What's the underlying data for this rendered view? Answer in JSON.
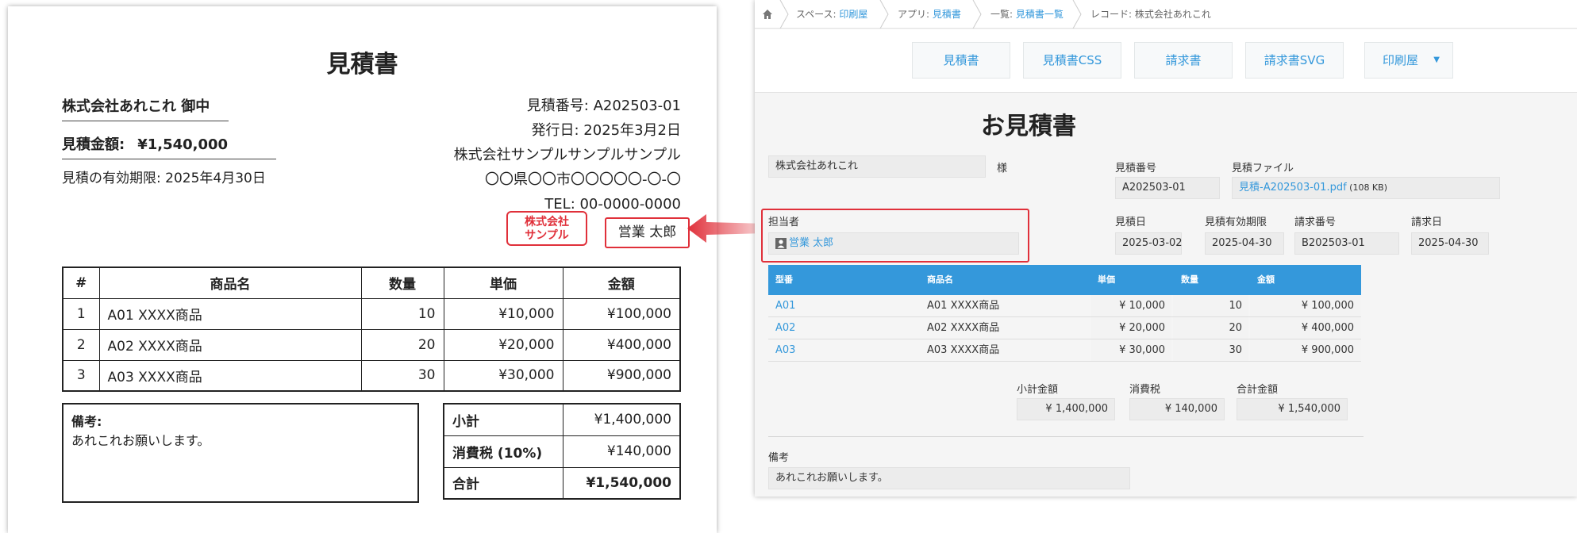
{
  "document": {
    "title": "見積書",
    "customer": "株式会社あれこれ 御中",
    "amount_label": "見積金額:",
    "amount_value": "¥1,540,000",
    "validity": "見積の有効期限: 2025年4月30日",
    "quote_number": "見積番号: A202503-01",
    "issue_date": "発行日: 2025年3月2日",
    "company": "株式会社サンプルサンプルサンプル",
    "address": "〇〇県〇〇市〇〇〇〇〇-〇-〇",
    "tel": "TEL: 00-0000-0000",
    "stamp_line1": "株式会社",
    "stamp_line2": "サンプル",
    "representative": "営業 太郎",
    "table_headers": [
      "#",
      "商品名",
      "数量",
      "単価",
      "金額"
    ],
    "items": [
      {
        "no": "1",
        "name": "A01 XXXX商品",
        "qty": "10",
        "price": "¥10,000",
        "amount": "¥100,000"
      },
      {
        "no": "2",
        "name": "A02 XXXX商品",
        "qty": "20",
        "price": "¥20,000",
        "amount": "¥400,000"
      },
      {
        "no": "3",
        "name": "A03 XXXX商品",
        "qty": "30",
        "price": "¥30,000",
        "amount": "¥900,000"
      }
    ],
    "notes_label": "備考:",
    "notes_text": "あれこれお願いします。",
    "subtotal_label": "小計",
    "subtotal": "¥1,400,000",
    "tax_label": "消費税 (10%)",
    "tax": "¥140,000",
    "total_label": "合計",
    "total": "¥1,540,000"
  },
  "app": {
    "breadcrumb": {
      "space_prefix": "スペース: ",
      "space": "印刷屋",
      "app_prefix": "アプリ: ",
      "app": "見積書",
      "list_prefix": "一覧: ",
      "list": "見積書一覧",
      "record_prefix": "レコード: ",
      "record": "株式会社あれこれ"
    },
    "toolbar": {
      "buttons": [
        "見積書",
        "見積書CSS",
        "請求書",
        "請求書SVG",
        "印刷屋"
      ]
    },
    "record": {
      "title": "お見積書",
      "customer_value": "株式会社あれこれ",
      "honorific": "様",
      "quote_number_label": "見積番号",
      "quote_number": "A202503-01",
      "quote_file_label": "見積ファイル",
      "quote_file_name": "見積-A202503-01.pdf",
      "quote_file_size": " (108 KB)",
      "rep_label": "担当者",
      "rep_name": "営業 太郎",
      "quote_date_label": "見積日",
      "quote_date": "2025-03-02",
      "valid_until_label": "見積有効期限",
      "valid_until": "2025-04-30",
      "invoice_number_label": "請求番号",
      "invoice_number": "B202503-01",
      "invoice_date_label": "請求日",
      "invoice_date": "2025-04-30",
      "sub_headers": [
        "型番",
        "商品名",
        "単価",
        "数量",
        "金額"
      ],
      "sub_rows": [
        {
          "code": "A01",
          "name": "A01 XXXX商品",
          "price": "¥ 10,000",
          "qty": "10",
          "amount": "¥ 100,000"
        },
        {
          "code": "A02",
          "name": "A02 XXXX商品",
          "price": "¥ 20,000",
          "qty": "20",
          "amount": "¥ 400,000"
        },
        {
          "code": "A03",
          "name": "A03 XXXX商品",
          "price": "¥ 30,000",
          "qty": "30",
          "amount": "¥ 900,000"
        }
      ],
      "subtotal_label": "小計金額",
      "subtotal": "¥ 1,400,000",
      "tax_label": "消費税",
      "tax": "¥ 140,000",
      "total_label": "合計金額",
      "total": "¥ 1,540,000",
      "notes_label": "備考",
      "notes": "あれこれお願いします。"
    }
  },
  "colors": {
    "accent_blue": "#3498db",
    "highlight_red": "#e0303a"
  }
}
